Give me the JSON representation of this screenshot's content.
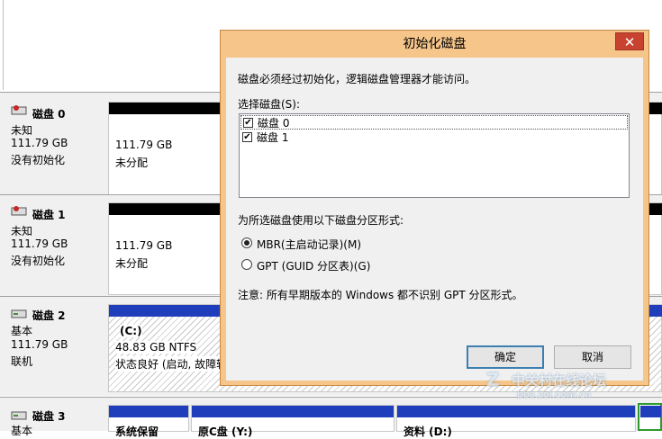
{
  "disks": [
    {
      "title": "磁盘 0",
      "type": "未知",
      "size": "111.79 GB",
      "status": "没有初始化",
      "partition": {
        "size": "111.79 GB",
        "state": "未分配"
      }
    },
    {
      "title": "磁盘 1",
      "type": "未知",
      "size": "111.79 GB",
      "status": "没有初始化",
      "partition": {
        "size": "111.79 GB",
        "state": "未分配"
      }
    },
    {
      "title": "磁盘 2",
      "type": "基本",
      "size": "111.79 GB",
      "status": "联机",
      "partition": {
        "name": "(C:)",
        "size": "48.83 GB NTFS",
        "state": "状态良好 (启动, 故障转"
      }
    },
    {
      "title": "磁盘 3",
      "type": "基本",
      "partitions": [
        "系统保留",
        "原C盘 (Y:)",
        "资料 (D:)"
      ]
    }
  ],
  "dialog": {
    "title": "初始化磁盘",
    "close_glyph": "✕",
    "intro": "磁盘必须经过初始化，逻辑磁盘管理器才能访问。",
    "select_label": "选择磁盘(S):",
    "disks": [
      {
        "label": "磁盘 0",
        "checked": "✔"
      },
      {
        "label": "磁盘 1",
        "checked": "✔"
      }
    ],
    "style_label": "为所选磁盘使用以下磁盘分区形式:",
    "options": [
      "MBR(主启动记录)(M)",
      "GPT (GUID 分区表)(G)"
    ],
    "note": "注意: 所有早期版本的 Windows 都不识别 GPT 分区形式。",
    "ok": "确定",
    "cancel": "取消"
  },
  "watermark": {
    "main": "中关村在线论坛",
    "sub": "bbs.zol.com.cn"
  },
  "colors": {
    "unallocated_bar": "#000000",
    "primary_bar": "#1f3ebb",
    "dialog_frame": "#f5c58a",
    "close_button": "#c7432f"
  }
}
